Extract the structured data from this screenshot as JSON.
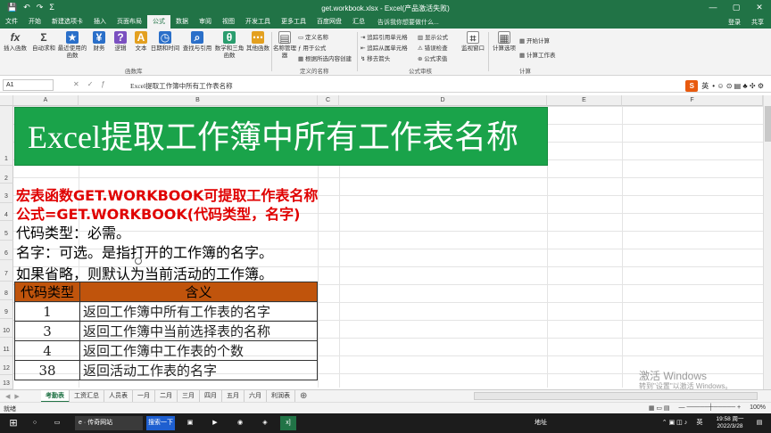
{
  "titlebar": {
    "title": "get.workbook.xlsx - Excel(产品激活失败)",
    "save_icon": "💾",
    "undo_icon": "↶",
    "redo_icon": "↷",
    "sum_icon": "Σ",
    "min": "—",
    "max": "▢",
    "close": "✕"
  },
  "menu": {
    "tabs": [
      "文件",
      "开始",
      "新建选项卡",
      "插入",
      "页面布局",
      "公式",
      "数据",
      "审阅",
      "视图",
      "开发工具",
      "更多工具",
      "百度网盘",
      "汇总"
    ],
    "active": "公式",
    "tell": "告诉我你想要做什么...",
    "login": "登录",
    "share": "共享"
  },
  "ribbon": {
    "insert_function": "插入函数",
    "autosum": "自动求和",
    "recent": "最近使用的函数",
    "financial": "财务",
    "logical": "逻辑",
    "text": "文本",
    "datetime": "日期和时间",
    "lookup": "查找与引用",
    "math": "数学和三角函数",
    "more": "其他函数",
    "library_group": "函数库",
    "name_manager": "名称管理器",
    "define_name": "定义名称",
    "use_in_formula": "用于公式",
    "create_from_selection": "根据所选内容创建",
    "names_group": "定义的名称",
    "trace_precedents": "追踪引用单元格",
    "trace_dependents": "追踪从属单元格",
    "remove_arrows": "移去箭头",
    "show_formulas": "显示公式",
    "error_checking": "错误检查",
    "evaluate_formula": "公式求值",
    "audit_group": "公式审核",
    "watch_window": "监视窗口",
    "calc_options": "计算选项",
    "calc_now": "开始计算",
    "calc_sheet": "计算工作表",
    "calc_group": "计算"
  },
  "formula_bar": {
    "name_box": "A1",
    "formula": "Excel提取工作簿中所有工作表名称",
    "sogou": "S",
    "ime": "英"
  },
  "columns": [
    "A",
    "B",
    "C",
    "D",
    "E",
    "F"
  ],
  "rows": [
    "1",
    "2",
    "3",
    "4",
    "5",
    "6",
    "7",
    "8",
    "9",
    "10",
    "11",
    "12",
    "13"
  ],
  "sheet": {
    "banner": "Excel提取工作簿中所有工作表名称",
    "line3": "宏表函数GET.WORKBOOK可提取工作表名称",
    "line4": "公式=GET.WORKBOOK(代码类型，名字)",
    "line5": "代码类型：必需。",
    "line6": "名字：可选。是指打开的工作簿的名字。",
    "line7": "如果省略，则默认为当前活动的工作簿。",
    "table_header": [
      "代码类型",
      "含义"
    ],
    "table_rows": [
      [
        "1",
        "返回工作簿中所有工作表的名字"
      ],
      [
        "3",
        "返回工作簿中当前选择表的名称"
      ],
      [
        "4",
        "返回工作簿中工作表的个数"
      ],
      [
        "38",
        "返回活动工作表的名字"
      ]
    ]
  },
  "sheet_tabs": [
    "考勤表",
    "工资汇总",
    "人员表",
    "一月",
    "二月",
    "三月",
    "四月",
    "五月",
    "六月",
    "利润表"
  ],
  "active_tab": "考勤表",
  "status": {
    "ready": "就绪",
    "zoom": "100%"
  },
  "watermark": {
    "line1": "激活 Windows",
    "line2": "转到\"设置\"以激活 Windows。"
  },
  "taskbar": {
    "browser": "传奇网站",
    "search": "搜索一下",
    "excel": "x]",
    "address": "地址",
    "time": "19:58 周一",
    "date": "2022/3/28",
    "ime": "英"
  }
}
